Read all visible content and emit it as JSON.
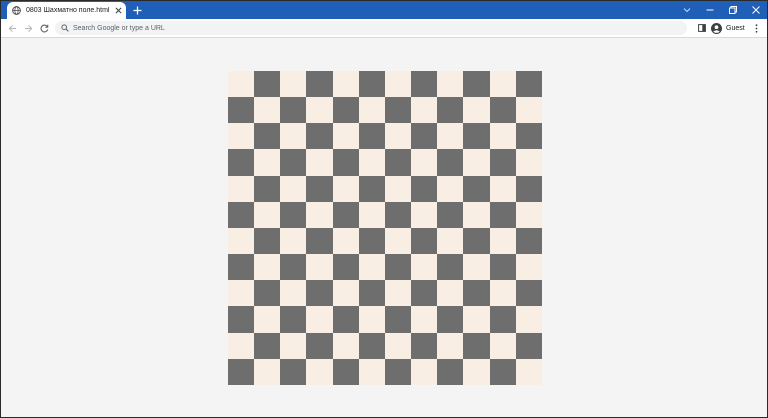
{
  "browser": {
    "tab": {
      "title": "0803 Шахматно поле.html",
      "favicon": "globe-icon"
    },
    "profile_name": "Guest",
    "omnibox_placeholder": "Search Google or type a URL",
    "colors": {
      "titlebar": "#1f5fb8",
      "toolbar": "#ffffff",
      "omnibox": "#f1f3f4"
    }
  },
  "page": {
    "background": "#f4f4f4",
    "board": {
      "rows": 12,
      "cols": 12,
      "light_color": "#f8eee3",
      "dark_color": "#6e6e6e",
      "top_left": "light"
    }
  }
}
